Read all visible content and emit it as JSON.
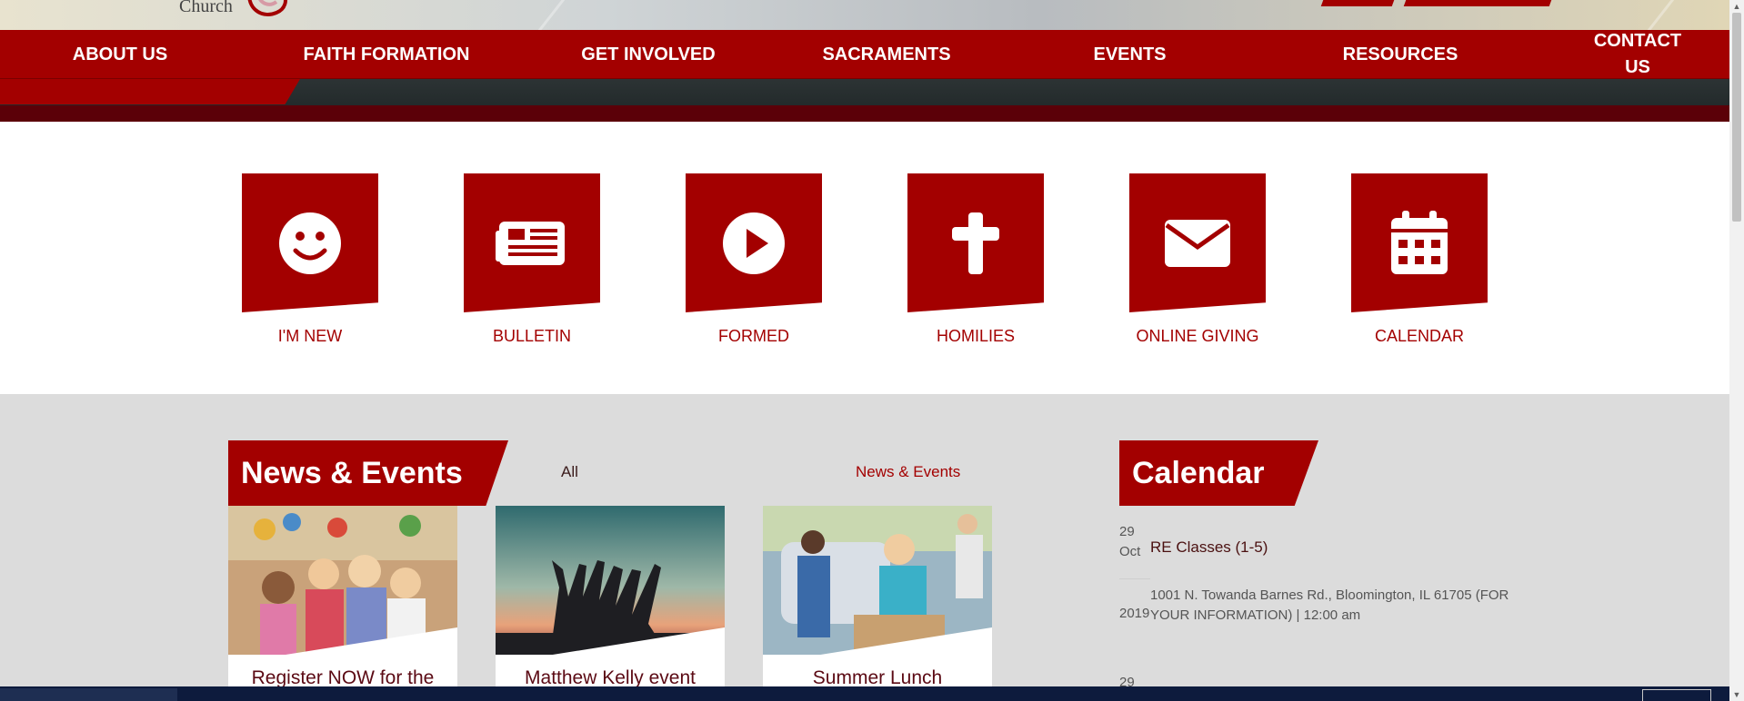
{
  "brand": {
    "church_word": "Church",
    "accent_color": "#a30000",
    "dark_band_color": "#5b0008"
  },
  "nav": {
    "items": [
      {
        "label": "ABOUT US"
      },
      {
        "label": "FAITH FORMATION"
      },
      {
        "label": "GET INVOLVED"
      },
      {
        "label": "SACRAMENTS"
      },
      {
        "label": "EVENTS"
      },
      {
        "label": "RESOURCES"
      },
      {
        "label": "CONTACT US"
      }
    ]
  },
  "quick_links": [
    {
      "label": "I'M NEW",
      "icon": "smiley-icon"
    },
    {
      "label": "BULLETIN",
      "icon": "newspaper-icon"
    },
    {
      "label": "FORMED",
      "icon": "play-icon"
    },
    {
      "label": "HOMILIES",
      "icon": "cross-icon"
    },
    {
      "label": "ONLINE GIVING",
      "icon": "envelope-icon"
    },
    {
      "label": "CALENDAR",
      "icon": "calendar-icon"
    }
  ],
  "news": {
    "heading": "News & Events",
    "filters": {
      "all": "All",
      "news_events": "News & Events"
    },
    "cards": [
      {
        "title": "Register NOW for the"
      },
      {
        "title": "Matthew Kelly event"
      },
      {
        "title": "Summer Lunch"
      }
    ]
  },
  "calendar": {
    "heading": "Calendar",
    "entries": [
      {
        "day": "29",
        "month": "Oct",
        "year": "2019",
        "title": "RE Classes (1-5)",
        "location": "1001 N. Towanda Barnes Rd., Bloomington, IL 61705 (FOR YOUR INFORMATION) | 12:00 am"
      },
      {
        "day": "29"
      }
    ]
  }
}
